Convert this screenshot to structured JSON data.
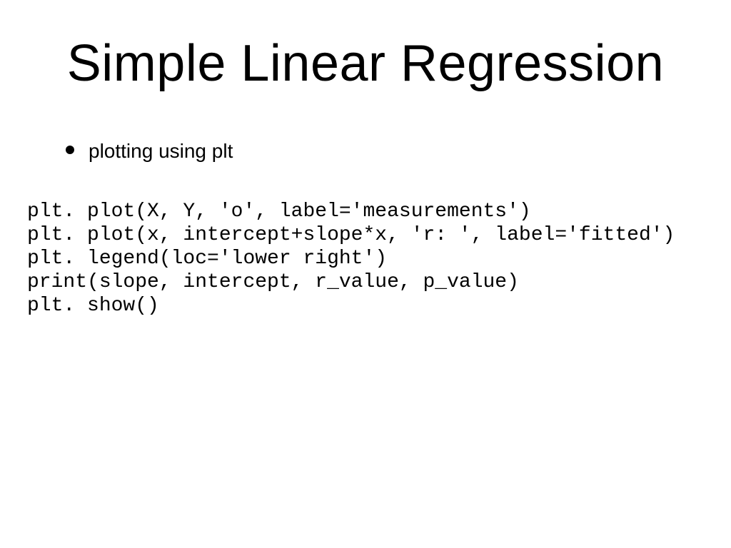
{
  "title": "Simple Linear Regression",
  "bullet": "plotting using plt",
  "code": {
    "line1": "plt. plot(X, Y, 'o', label='measurements')",
    "line2": "plt. plot(x, intercept+slope*x, 'r: ', label='fitted')",
    "line3": "plt. legend(loc='lower right')",
    "line4": "print(slope, intercept, r_value, p_value)",
    "line5": "plt. show()"
  }
}
